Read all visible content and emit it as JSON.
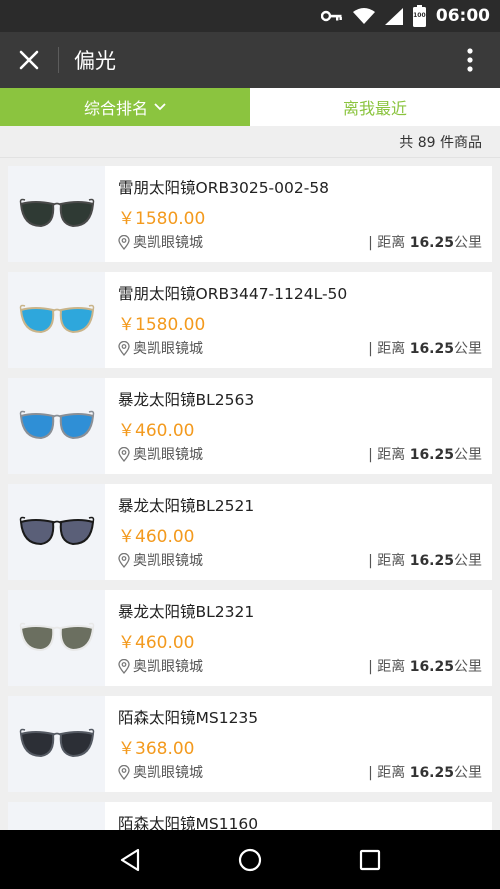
{
  "status_bar": {
    "time": "06:00",
    "battery_level": "100"
  },
  "header": {
    "title": "偏光"
  },
  "sort_tabs": {
    "composite_label": "综合排名",
    "nearest_label": "离我最近"
  },
  "summary": {
    "count_text": "共 89 件商品"
  },
  "products": [
    {
      "name": "雷朋太阳镜ORB3025-002-58",
      "price": "￥1580.00",
      "store": "奥凯眼镜城",
      "distance_prefix": "| 距离 ",
      "distance_value": "16.25",
      "distance_unit": "公里",
      "frame_color": "#4a4a4a",
      "lens_color": "#2f3a34"
    },
    {
      "name": "雷朋太阳镜ORB3447-1124L-50",
      "price": "￥1580.00",
      "store": "奥凯眼镜城",
      "distance_prefix": "| 距离 ",
      "distance_value": "16.25",
      "distance_unit": "公里",
      "frame_color": "#c9b48a",
      "lens_color": "#2ea7dc"
    },
    {
      "name": "暴龙太阳镜BL2563",
      "price": "￥460.00",
      "store": "奥凯眼镜城",
      "distance_prefix": "| 距离 ",
      "distance_value": "16.25",
      "distance_unit": "公里",
      "frame_color": "#8a8f96",
      "lens_color": "#2f8fd6"
    },
    {
      "name": "暴龙太阳镜BL2521",
      "price": "￥460.00",
      "store": "奥凯眼镜城",
      "distance_prefix": "| 距离 ",
      "distance_value": "16.25",
      "distance_unit": "公里",
      "frame_color": "#1a1a1a",
      "lens_color": "#5a5f78"
    },
    {
      "name": "暴龙太阳镜BL2321",
      "price": "￥460.00",
      "store": "奥凯眼镜城",
      "distance_prefix": "| 距离 ",
      "distance_value": "16.25",
      "distance_unit": "公里",
      "frame_color": "#e8e8e8",
      "lens_color": "#6b6f60"
    },
    {
      "name": "陌森太阳镜MS1235",
      "price": "￥368.00",
      "store": "奥凯眼镜城",
      "distance_prefix": "| 距离 ",
      "distance_value": "16.25",
      "distance_unit": "公里",
      "frame_color": "#555a63",
      "lens_color": "#2c2f36"
    },
    {
      "name": "陌森太阳镜MS1160",
      "price": "",
      "store": "",
      "distance_prefix": "",
      "distance_value": "",
      "distance_unit": "",
      "frame_color": "#555a63",
      "lens_color": "#2c2f36"
    }
  ],
  "colors": {
    "accent_green": "#8bc43f",
    "price_orange": "#f39a1e",
    "title_bar": "#3a3a3a",
    "status_bar": "#2b2b2b"
  },
  "icons": {
    "close": "close-icon",
    "more": "more-vertical-icon",
    "chevron": "chevron-down-icon",
    "location": "location-pin-icon",
    "back": "nav-back-icon",
    "home": "nav-home-icon",
    "recents": "nav-recents-icon"
  }
}
